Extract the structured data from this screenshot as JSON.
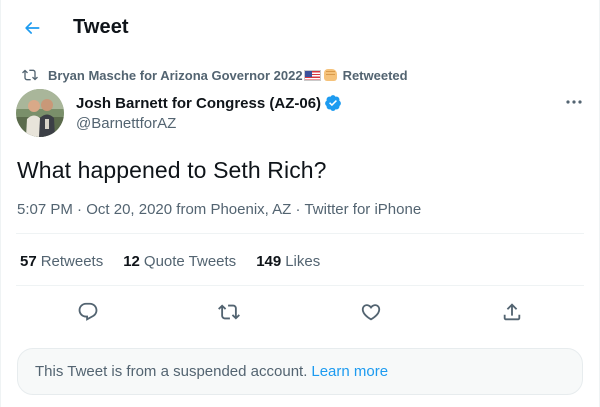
{
  "header": {
    "title": "Tweet",
    "back_icon": "arrow-left-icon"
  },
  "retweet": {
    "icon": "retweet-icon",
    "name": "Bryan Masche for Arizona Governor 2022",
    "emoji": [
      "us-flag-emoji",
      "fist-emoji"
    ],
    "suffix": "Retweeted"
  },
  "author": {
    "name": "Josh Barnett for Congress (AZ-06)",
    "handle": "@BarnettforAZ",
    "verified": true
  },
  "tweet": {
    "text": "What happened to Seth Rich?",
    "time": "5:07 PM",
    "date": "Oct 20, 2020",
    "location": "from Phoenix, AZ",
    "source": "Twitter for iPhone",
    "separator": "·"
  },
  "stats": {
    "retweets_count": "57",
    "retweets_label": "Retweets",
    "quotes_count": "12",
    "quotes_label": "Quote Tweets",
    "likes_count": "149",
    "likes_label": "Likes"
  },
  "actions": [
    "reply-icon",
    "retweet-icon",
    "like-icon",
    "share-icon"
  ],
  "notice": {
    "text": "This Tweet is from a suspended account.",
    "link": "Learn more"
  },
  "colors": {
    "accent": "#1d9bf0",
    "text_primary": "#0f1419",
    "text_secondary": "#536471",
    "divider": "#eff3f4",
    "notice_bg": "#f7f9f9"
  }
}
